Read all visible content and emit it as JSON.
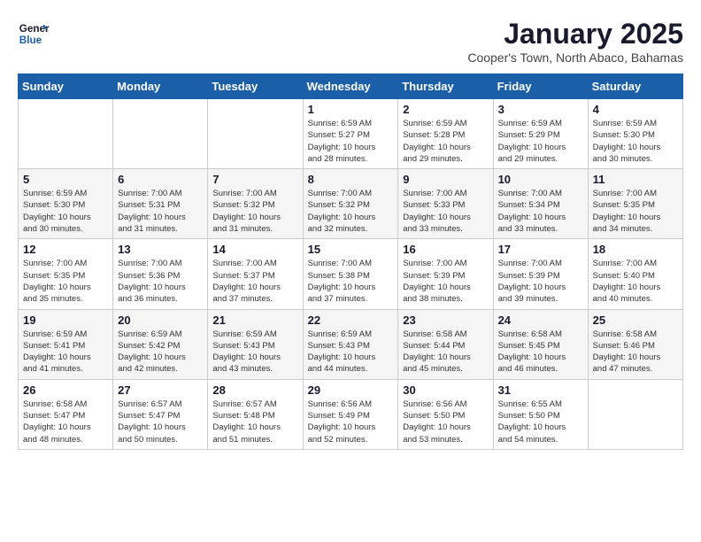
{
  "logo": {
    "line1": "General",
    "line2": "Blue"
  },
  "title": "January 2025",
  "subtitle": "Cooper's Town, North Abaco, Bahamas",
  "days_of_week": [
    "Sunday",
    "Monday",
    "Tuesday",
    "Wednesday",
    "Thursday",
    "Friday",
    "Saturday"
  ],
  "weeks": [
    [
      {
        "day": "",
        "info": ""
      },
      {
        "day": "",
        "info": ""
      },
      {
        "day": "",
        "info": ""
      },
      {
        "day": "1",
        "info": "Sunrise: 6:59 AM\nSunset: 5:27 PM\nDaylight: 10 hours\nand 28 minutes."
      },
      {
        "day": "2",
        "info": "Sunrise: 6:59 AM\nSunset: 5:28 PM\nDaylight: 10 hours\nand 29 minutes."
      },
      {
        "day": "3",
        "info": "Sunrise: 6:59 AM\nSunset: 5:29 PM\nDaylight: 10 hours\nand 29 minutes."
      },
      {
        "day": "4",
        "info": "Sunrise: 6:59 AM\nSunset: 5:30 PM\nDaylight: 10 hours\nand 30 minutes."
      }
    ],
    [
      {
        "day": "5",
        "info": "Sunrise: 6:59 AM\nSunset: 5:30 PM\nDaylight: 10 hours\nand 30 minutes."
      },
      {
        "day": "6",
        "info": "Sunrise: 7:00 AM\nSunset: 5:31 PM\nDaylight: 10 hours\nand 31 minutes."
      },
      {
        "day": "7",
        "info": "Sunrise: 7:00 AM\nSunset: 5:32 PM\nDaylight: 10 hours\nand 31 minutes."
      },
      {
        "day": "8",
        "info": "Sunrise: 7:00 AM\nSunset: 5:32 PM\nDaylight: 10 hours\nand 32 minutes."
      },
      {
        "day": "9",
        "info": "Sunrise: 7:00 AM\nSunset: 5:33 PM\nDaylight: 10 hours\nand 33 minutes."
      },
      {
        "day": "10",
        "info": "Sunrise: 7:00 AM\nSunset: 5:34 PM\nDaylight: 10 hours\nand 33 minutes."
      },
      {
        "day": "11",
        "info": "Sunrise: 7:00 AM\nSunset: 5:35 PM\nDaylight: 10 hours\nand 34 minutes."
      }
    ],
    [
      {
        "day": "12",
        "info": "Sunrise: 7:00 AM\nSunset: 5:35 PM\nDaylight: 10 hours\nand 35 minutes."
      },
      {
        "day": "13",
        "info": "Sunrise: 7:00 AM\nSunset: 5:36 PM\nDaylight: 10 hours\nand 36 minutes."
      },
      {
        "day": "14",
        "info": "Sunrise: 7:00 AM\nSunset: 5:37 PM\nDaylight: 10 hours\nand 37 minutes."
      },
      {
        "day": "15",
        "info": "Sunrise: 7:00 AM\nSunset: 5:38 PM\nDaylight: 10 hours\nand 37 minutes."
      },
      {
        "day": "16",
        "info": "Sunrise: 7:00 AM\nSunset: 5:39 PM\nDaylight: 10 hours\nand 38 minutes."
      },
      {
        "day": "17",
        "info": "Sunrise: 7:00 AM\nSunset: 5:39 PM\nDaylight: 10 hours\nand 39 minutes."
      },
      {
        "day": "18",
        "info": "Sunrise: 7:00 AM\nSunset: 5:40 PM\nDaylight: 10 hours\nand 40 minutes."
      }
    ],
    [
      {
        "day": "19",
        "info": "Sunrise: 6:59 AM\nSunset: 5:41 PM\nDaylight: 10 hours\nand 41 minutes."
      },
      {
        "day": "20",
        "info": "Sunrise: 6:59 AM\nSunset: 5:42 PM\nDaylight: 10 hours\nand 42 minutes."
      },
      {
        "day": "21",
        "info": "Sunrise: 6:59 AM\nSunset: 5:43 PM\nDaylight: 10 hours\nand 43 minutes."
      },
      {
        "day": "22",
        "info": "Sunrise: 6:59 AM\nSunset: 5:43 PM\nDaylight: 10 hours\nand 44 minutes."
      },
      {
        "day": "23",
        "info": "Sunrise: 6:58 AM\nSunset: 5:44 PM\nDaylight: 10 hours\nand 45 minutes."
      },
      {
        "day": "24",
        "info": "Sunrise: 6:58 AM\nSunset: 5:45 PM\nDaylight: 10 hours\nand 46 minutes."
      },
      {
        "day": "25",
        "info": "Sunrise: 6:58 AM\nSunset: 5:46 PM\nDaylight: 10 hours\nand 47 minutes."
      }
    ],
    [
      {
        "day": "26",
        "info": "Sunrise: 6:58 AM\nSunset: 5:47 PM\nDaylight: 10 hours\nand 48 minutes."
      },
      {
        "day": "27",
        "info": "Sunrise: 6:57 AM\nSunset: 5:47 PM\nDaylight: 10 hours\nand 50 minutes."
      },
      {
        "day": "28",
        "info": "Sunrise: 6:57 AM\nSunset: 5:48 PM\nDaylight: 10 hours\nand 51 minutes."
      },
      {
        "day": "29",
        "info": "Sunrise: 6:56 AM\nSunset: 5:49 PM\nDaylight: 10 hours\nand 52 minutes."
      },
      {
        "day": "30",
        "info": "Sunrise: 6:56 AM\nSunset: 5:50 PM\nDaylight: 10 hours\nand 53 minutes."
      },
      {
        "day": "31",
        "info": "Sunrise: 6:55 AM\nSunset: 5:50 PM\nDaylight: 10 hours\nand 54 minutes."
      },
      {
        "day": "",
        "info": ""
      }
    ]
  ],
  "alt_rows": [
    1,
    3
  ]
}
